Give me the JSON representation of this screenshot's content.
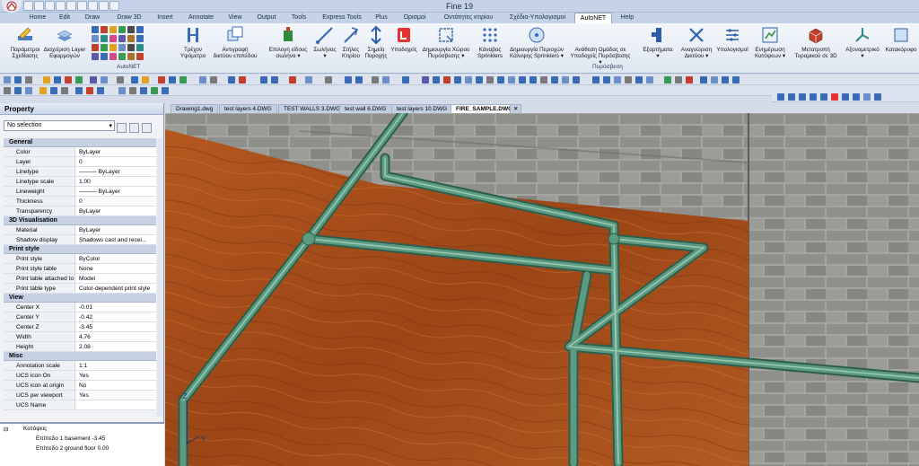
{
  "app": {
    "title": "Fine 19"
  },
  "menu_tabs": [
    "Home",
    "Edit",
    "Draw",
    "Draw 3D",
    "Insert",
    "Annotate",
    "View",
    "Output",
    "Tools",
    "Express Tools",
    "Plus",
    "Ορισμοί",
    "Οντότητες κτιρίου",
    "Σχέδια-Υπολογισμοί",
    "AutoNET",
    "Help"
  ],
  "active_tab": "AutoNET",
  "ribbon": {
    "left_buttons": [
      {
        "label1": "Παράμετροι",
        "label2": "Σχεδίασης"
      },
      {
        "label1": "Διαχείριση Layer",
        "label2": "Εφαρμογών"
      }
    ],
    "autonet_group_label": "AutoNET",
    "level_buttons": [
      {
        "label1": "Τρέχον",
        "label2": "Υψόμετρο"
      },
      {
        "label1": "Αντιγραφή",
        "label2": "δικτύου επιπέδου"
      }
    ],
    "fire_buttons": [
      {
        "label1": "Επιλογή είδους",
        "label2": "σωλήνα ▾"
      },
      {
        "label1": "Σωλήνας",
        "label2": "▾"
      },
      {
        "label1": "Στήλες",
        "label2": "Κτιρίου"
      },
      {
        "label1": "Σημείο",
        "label2": "Παροχής"
      },
      {
        "label1": "Υποδοχείς",
        "label2": ""
      },
      {
        "label1": "Δημιουργία Χώρου",
        "label2": "Πυρόσβεσης ▾"
      },
      {
        "label1": "Κάναβος",
        "label2": "Sprinklers"
      },
      {
        "label1": "Δημιουργία Περιοχών",
        "label2": "Κάλυψης Sprinklers ▾"
      },
      {
        "label1": "Ανάθεση Ομάδας σε",
        "label2": "Υποδοχείς Πυρόσβεσης ▾"
      },
      {
        "label1": "Εξαρτήματα",
        "label2": "▾"
      },
      {
        "label1": "Αναγνώριση",
        "label2": "Δικτύου ▾"
      },
      {
        "label1": "Υπολογισμοί",
        "label2": ""
      },
      {
        "label1": "Ενημέρωση",
        "label2": "Κατόψεων ▾"
      },
      {
        "label1": "Μετατροπή",
        "label2": "Τυραμικού σε 3D"
      },
      {
        "label1": "Αξονομετρικό",
        "label2": "▾"
      },
      {
        "label1": "Κατακόρυφο",
        "label2": ""
      }
    ],
    "fire_group_label": "Πυρόσβεση"
  },
  "properties": {
    "title": "Property",
    "selection": "No selection",
    "categories": [
      {
        "name": "General",
        "rows": [
          {
            "k": "Color",
            "v": "ByLayer"
          },
          {
            "k": "Layer",
            "v": "0"
          },
          {
            "k": "Linetype",
            "v": "——— ByLayer"
          },
          {
            "k": "Linetype scale",
            "v": "1.00"
          },
          {
            "k": "Lineweight",
            "v": "——— ByLayer"
          },
          {
            "k": "Thickness",
            "v": "0"
          },
          {
            "k": "Transparency",
            "v": "ByLayer"
          }
        ]
      },
      {
        "name": "3D Visualisation",
        "rows": [
          {
            "k": "Material",
            "v": "ByLayer"
          },
          {
            "k": "Shadow display",
            "v": "Shadows cast and recei..."
          }
        ]
      },
      {
        "name": "Print style",
        "rows": [
          {
            "k": "Print style",
            "v": "ByColor"
          },
          {
            "k": "Print style table",
            "v": "None"
          },
          {
            "k": "Print table attached to",
            "v": "Model"
          },
          {
            "k": "Print table type",
            "v": "Color-dependent print style"
          }
        ]
      },
      {
        "name": "View",
        "rows": [
          {
            "k": "Center X",
            "v": "-0.01"
          },
          {
            "k": "Center Y",
            "v": "-0.42"
          },
          {
            "k": "Center Z",
            "v": "-3.45"
          },
          {
            "k": "Width",
            "v": "4.76"
          },
          {
            "k": "Height",
            "v": "2.08"
          }
        ]
      },
      {
        "name": "Misc",
        "rows": [
          {
            "k": "Annotation scale",
            "v": "1:1"
          },
          {
            "k": "UCS icon On",
            "v": "Yes"
          },
          {
            "k": "UCS icon at origin",
            "v": "No"
          },
          {
            "k": "UCS per viewport",
            "v": "Yes"
          },
          {
            "k": "UCS Name",
            "v": ""
          }
        ]
      }
    ]
  },
  "tree": {
    "root": "Κατόψεις",
    "items": [
      "Επίπεδο 1 basement -3.45",
      "Επίπεδο 2 ground floor 0.00"
    ]
  },
  "doc_tabs": [
    "Drawing1.dwg",
    "test layers 4.DWG",
    "TEST WALLS 3.DWG",
    "test wall 6.DWG",
    "test layers 10.DWG",
    "FIRE_SAMPLE.DWG"
  ],
  "active_doc": "FIRE_SAMPLE.DWG",
  "ucs": {
    "z_label": "Z",
    "y_label": "Y"
  },
  "colors": {
    "pipe": "#5c9a82",
    "floor": "#a2501d",
    "wall": "#9a9a96",
    "accent": "#2c5a9e"
  }
}
